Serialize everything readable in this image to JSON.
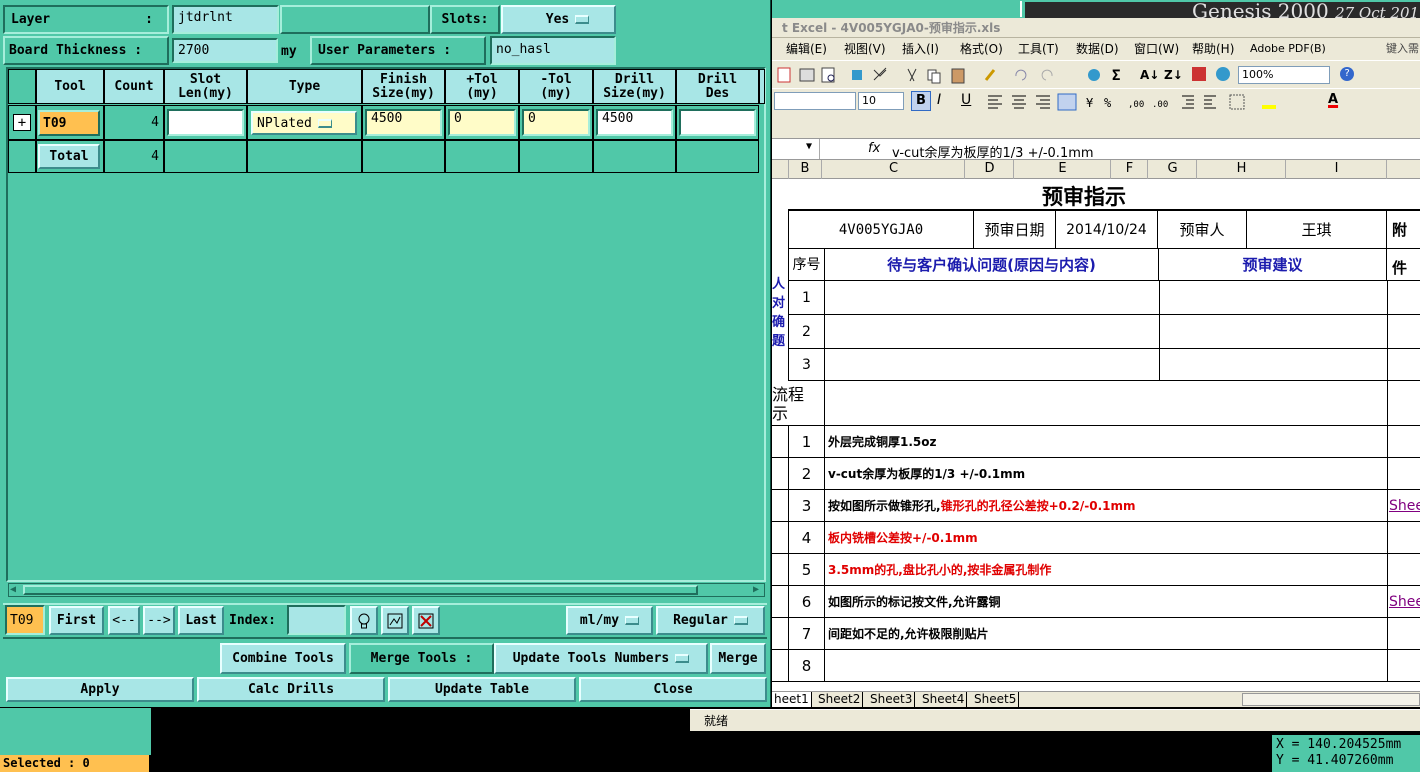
{
  "dialog": {
    "layer_label": "Layer",
    "layer_colon": ":",
    "layer_value": "jtdrlnt",
    "slots_label": "Slots:",
    "slots_value": "Yes",
    "thickness_label": "Board Thickness :",
    "thickness_value": "2700",
    "thickness_unit": "my",
    "user_params_label": "User Parameters :",
    "user_params_value": "no_hasl",
    "columns": [
      "Tool",
      "Count",
      "Slot\nLen(my)",
      "Type",
      "Finish\nSize(my)",
      "+Tol\n(my)",
      "-Tol\n(my)",
      "Drill\nSize(my)",
      "Drill\nDes"
    ],
    "row": {
      "tool": "T09",
      "count": "4",
      "slot_len": "",
      "type": "NPlated",
      "finish": "4500",
      "ptol": "0",
      "ntol": "0",
      "drill": "4500",
      "des": ""
    },
    "total": {
      "label": "Total",
      "count": "4"
    },
    "nav": {
      "current": "T09",
      "first": "First",
      "prev": "<--",
      "next": "-->",
      "last": "Last",
      "index_label": "Index:",
      "units": "ml/my",
      "mode": "Regular"
    },
    "tools": {
      "combine": "Combine Tools",
      "merge_label": "Merge Tools :",
      "merge_value": "Update Tools Numbers",
      "merge": "Merge"
    },
    "actions": {
      "apply": "Apply",
      "calc": "Calc Drills",
      "update": "Update Table",
      "close": "Close"
    }
  },
  "status": {
    "selected": "Selected : 0",
    "x": "X = 140.204525mm",
    "y": "Y = 41.407260mm"
  },
  "bg_title": {
    "genesis": "Genesis 2000",
    "date": "27 Oct 201"
  },
  "excel": {
    "title": "t Excel - 4V005YGJA0-预审指示.xls",
    "menu": [
      "编辑(E)",
      "视图(V)",
      "插入(I)",
      "格式(O)",
      "工具(T)",
      "数据(D)",
      "窗口(W)",
      "帮助(H)",
      "Adobe PDF(B)"
    ],
    "help_box": "键入需",
    "zoom": "100%",
    "font_size": "10",
    "formula": "v-cut余厚为板厚的1/3 +/-0.1mm",
    "fx": "fx",
    "col_headers": [
      "B",
      "C",
      "D",
      "E",
      "F",
      "G",
      "H",
      "I"
    ],
    "sheet_title": "预审指示",
    "job": "4V005YGJA0",
    "date_label": "预审日期",
    "date": "2014/10/24",
    "reviewer_label": "预审人",
    "reviewer": "王琪",
    "attach_label": "附件",
    "seq_label": "序号",
    "q_header": "待与客户确认问题(原因与内容)",
    "s_header": "预审建议",
    "left_vertical": "人对确题",
    "section2": "流程\n示",
    "q_rows": [
      "1",
      "2",
      "3"
    ],
    "items": [
      {
        "n": "1",
        "t": "外层完成铜厚1.5oz",
        "red": "",
        "link": ""
      },
      {
        "n": "2",
        "t": "v-cut余厚为板厚的1/3 +/-0.1mm",
        "red": "",
        "link": ""
      },
      {
        "n": "3",
        "t": "按如图所示做锥形孔,",
        "red": "锥形孔的孔径公差按+0.2/-0.1mm",
        "link": "Shee"
      },
      {
        "n": "4",
        "t": "",
        "red": "板内铣槽公差按+/-0.1mm",
        "link": ""
      },
      {
        "n": "5",
        "t": "",
        "red": "3.5mm的孔,盘比孔小的,按非金属孔制作",
        "link": ""
      },
      {
        "n": "6",
        "t": "如图所示的标记按文件,允许露铜",
        "red": "",
        "link": "Shee"
      },
      {
        "n": "7",
        "t": "间距如不足的,允许极限削贴片",
        "red": "",
        "link": ""
      },
      {
        "n": "8",
        "t": "",
        "red": "",
        "link": ""
      }
    ],
    "tabs": [
      "heet1",
      "Sheet2",
      "Sheet3",
      "Sheet4",
      "Sheet5"
    ],
    "status": "就绪"
  },
  "colors": {
    "dialog_bg": "#50c8a8",
    "light_button": "#a8e6e6",
    "tool_cell": "#ffc050",
    "selected_bar": "#ffc050",
    "excel_red": "#e00000",
    "excel_blue": "#1c1cae"
  }
}
